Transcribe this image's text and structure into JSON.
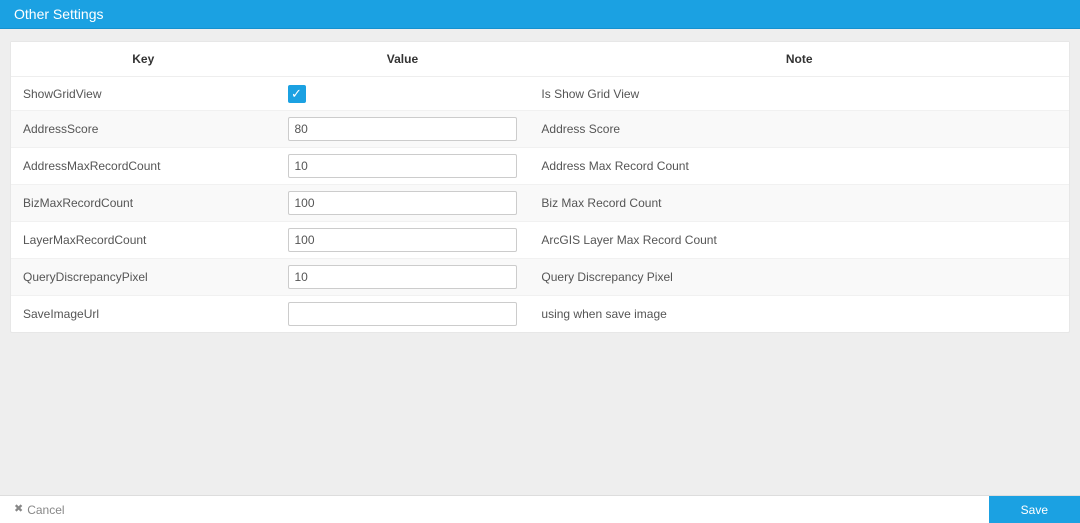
{
  "header": {
    "title": "Other Settings"
  },
  "table": {
    "headers": {
      "key": "Key",
      "value": "Value",
      "note": "Note"
    },
    "rows": [
      {
        "key": "ShowGridView",
        "type": "checkbox",
        "value": true,
        "note": "Is Show Grid View"
      },
      {
        "key": "AddressScore",
        "type": "text",
        "value": "80",
        "note": "Address Score"
      },
      {
        "key": "AddressMaxRecordCount",
        "type": "text",
        "value": "10",
        "note": "Address Max Record Count"
      },
      {
        "key": "BizMaxRecordCount",
        "type": "text",
        "value": "100",
        "note": "Biz Max Record Count"
      },
      {
        "key": "LayerMaxRecordCount",
        "type": "text",
        "value": "100",
        "note": "ArcGIS Layer Max Record Count"
      },
      {
        "key": "QueryDiscrepancyPixel",
        "type": "text",
        "value": "10",
        "note": "Query Discrepancy Pixel"
      },
      {
        "key": "SaveImageUrl",
        "type": "text",
        "value": "",
        "note": "using when save image"
      }
    ]
  },
  "footer": {
    "cancel_label": "Cancel",
    "save_label": "Save"
  }
}
